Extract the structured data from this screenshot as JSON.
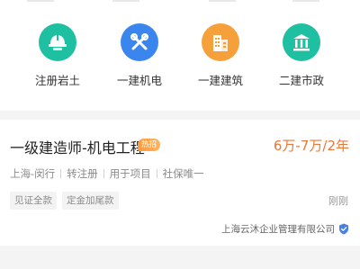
{
  "categories": [
    {
      "label": "注册岩土",
      "icon": "helmet-icon",
      "color": "#1fbfa2"
    },
    {
      "label": "一建机电",
      "icon": "tools-icon",
      "color": "#3a86ee"
    },
    {
      "label": "一建建筑",
      "icon": "building-icon",
      "color": "#f5a03a"
    },
    {
      "label": "二建市政",
      "icon": "government-icon",
      "color": "#1fbfa2"
    }
  ],
  "job": {
    "title": "一级建造师-机电工程",
    "badge": "热招",
    "salary": "6万-7万/2年",
    "meta": [
      "上海-闵行",
      "转注册",
      "用于项目",
      "社保唯一"
    ],
    "tags": [
      "见证全款",
      "定金加尾款"
    ],
    "time": "刚刚",
    "company": "上海云沐企业管理有限公司",
    "verify_icon": "verified-shield-icon"
  },
  "colors": {
    "salary": "#e8783a",
    "badge": "#ff9a3c",
    "teal": "#1fbfa2",
    "blue": "#3a86ee",
    "orange": "#f5a03a"
  }
}
